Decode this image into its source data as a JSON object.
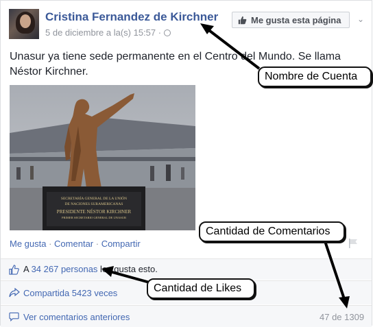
{
  "post": {
    "author": "Cristina Fernandez de Kirchner",
    "date": "5 de diciembre a la(s) 15:57 · ",
    "like_page_button": "Me gusta esta página",
    "text": "Unasur ya tiene sede permanente en el Centro del Mundo. Se llama Néstor Kirchner.",
    "photo_plaque": {
      "line1": "SECRETARÍA GENERAL DE LA UNIÓN",
      "line2": "DE NACIONES SURAMERICANAS",
      "line3": "PRESIDENTE NÉSTOR KIRCHNER",
      "line4": "PRIMER SECRETARIO GENERAL DE UNASUR"
    },
    "actions": {
      "like": "Me gusta",
      "comment": "Comentar",
      "share": "Compartir",
      "sep": " · "
    },
    "likes": {
      "prefix": "A ",
      "link": "34 267 personas",
      "suffix": " les gusta esto."
    },
    "shared": "Compartida 5423 veces",
    "comments": {
      "label": "Ver comentarios anteriores",
      "count": "47 de 1309"
    }
  },
  "annotations": {
    "account_name": "Nombre de Cuenta",
    "comment_count": "Cantidad de Comentarios",
    "likes_count": "Cantidad de Likes"
  },
  "colors": {
    "link": "#4267b2",
    "name": "#3b5998",
    "muted": "#90949c",
    "row_bg": "#f6f7f9"
  },
  "icons": [
    "thumbs-up-icon",
    "globe-icon",
    "chevron-down-icon",
    "flag-icon",
    "share-arrow-icon",
    "comment-bubble-icon"
  ]
}
